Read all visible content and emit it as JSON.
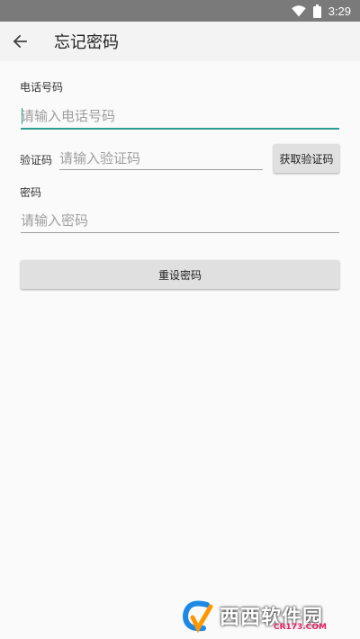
{
  "status_bar": {
    "time": "3:29",
    "icons": [
      "wifi-icon",
      "battery-icon"
    ]
  },
  "app_bar": {
    "title": "忘记密码",
    "back_icon": "arrow-left-icon"
  },
  "form": {
    "phone": {
      "label": "电话号码",
      "placeholder": "请输入电话号码",
      "value": ""
    },
    "code": {
      "label": "验证码",
      "placeholder": "请输入验证码",
      "value": "",
      "button_label": "获取验证码"
    },
    "password": {
      "label": "密码",
      "placeholder": "请输入密码",
      "value": ""
    },
    "submit_label": "重设密码"
  },
  "watermark": {
    "text": "西西软件园",
    "sub": "CR173.COM"
  },
  "colors": {
    "accent": "#2a9d8f",
    "status_bar": "#7a7a7a",
    "app_bar": "#f3f3f3",
    "background": "#fafafa",
    "button": "#e0e0e0"
  }
}
